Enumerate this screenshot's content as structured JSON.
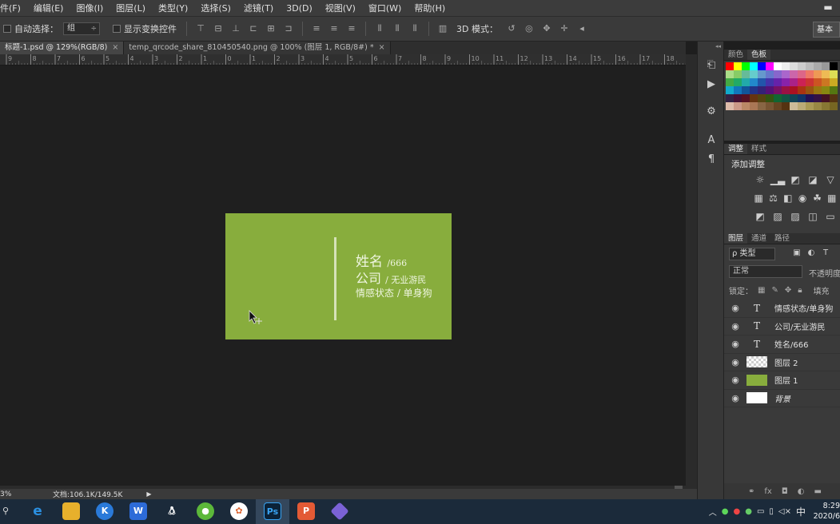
{
  "menu": [
    "件(F)",
    "编辑(E)",
    "图像(I)",
    "图层(L)",
    "类型(Y)",
    "选择(S)",
    "滤镜(T)",
    "3D(D)",
    "视图(V)",
    "窗口(W)",
    "帮助(H)"
  ],
  "options_bar": {
    "auto_select_label": "自动选择：",
    "auto_select_value": "组",
    "show_transform_label": "显示变换控件",
    "mode_3d_label": "3D 模式：",
    "workspace_button": "基本"
  },
  "doc_tabs": [
    {
      "label": "标题-1.psd @ 129%(RGB/8)",
      "close": "×"
    },
    {
      "label": "temp_qrcode_share_810450540.png @ 100% (图层 1, RGB/8#) *",
      "close": "×"
    }
  ],
  "ruler_numbers": [
    "9",
    "8",
    "7",
    "6",
    "5",
    "4",
    "3",
    "2",
    "1",
    "0",
    "1",
    "2",
    "3",
    "4",
    "5",
    "6",
    "7",
    "8",
    "9",
    "10",
    "11",
    "12",
    "13",
    "14",
    "15",
    "16",
    "17",
    "18"
  ],
  "card": {
    "name_big": "姓名",
    "name_small": "/666",
    "company_big": "公司",
    "company_small": "/ 无业游民",
    "status": "情感状态 / 单身狗",
    "color": "#88ad3d"
  },
  "status_bar": {
    "zoom": "3%",
    "doc_info": "文档:106.1K/149.5K"
  },
  "color_panel": {
    "tabs": [
      "颜色",
      "色板"
    ],
    "active_tab": 1
  },
  "adjust_panel": {
    "tabs": [
      "调整",
      "样式"
    ],
    "title": "添加调整"
  },
  "layers_panel": {
    "tabs": [
      "图层",
      "通道",
      "路径"
    ],
    "filter": "ρ 类型",
    "blend_mode": "正常",
    "opacity_label": "不透明度",
    "lock_label": "锁定：",
    "fill_label": "填充",
    "layers": [
      {
        "type": "text",
        "name": "情感状态/单身狗"
      },
      {
        "type": "text",
        "name": "公司/无业游民"
      },
      {
        "type": "text",
        "name": "姓名/666"
      },
      {
        "type": "transparent",
        "name": "图层 2"
      },
      {
        "type": "green",
        "name": "图层 1"
      },
      {
        "type": "white",
        "name": "背景"
      }
    ]
  },
  "taskbar": {
    "time": "8:29",
    "date": "2020/6",
    "ime": "中"
  }
}
